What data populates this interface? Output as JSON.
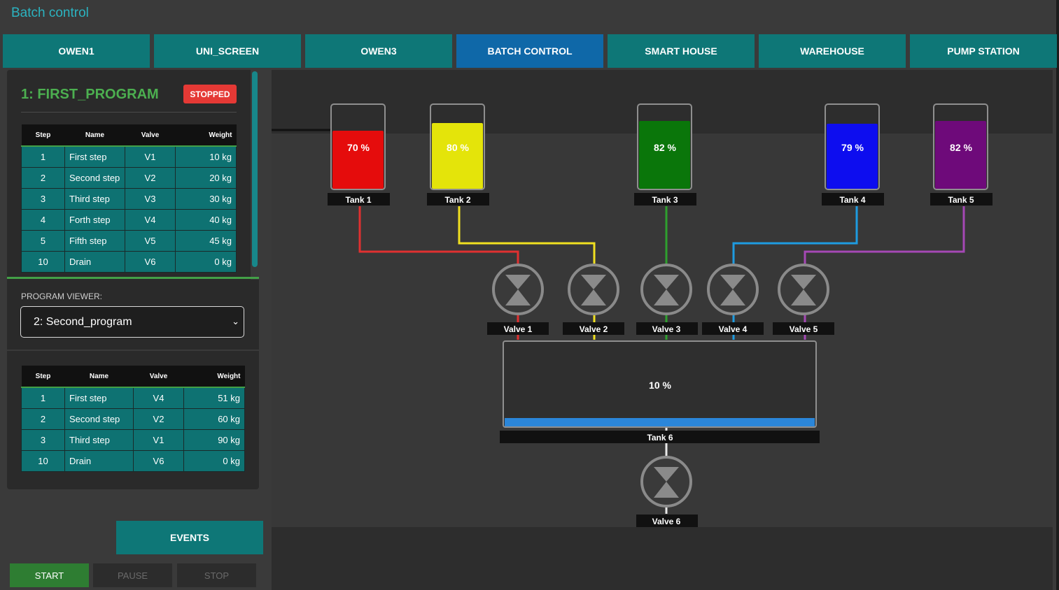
{
  "app": {
    "title": "Batch control"
  },
  "tabs": [
    {
      "label": "OWEN1",
      "active": false
    },
    {
      "label": "UNI_SCREEN",
      "active": false
    },
    {
      "label": "OWEN3",
      "active": false
    },
    {
      "label": "BATCH CONTROL",
      "active": true
    },
    {
      "label": "SMART HOUSE",
      "active": false
    },
    {
      "label": "WAREHOUSE",
      "active": false
    },
    {
      "label": "PUMP STATION",
      "active": false
    }
  ],
  "current_program": {
    "title": "1: FIRST_PROGRAM",
    "status": "STOPPED",
    "columns": {
      "step": "Step",
      "name": "Name",
      "valve": "Valve",
      "weight": "Weight"
    },
    "rows": [
      {
        "step": "1",
        "name": "First step",
        "valve": "V1",
        "weight": "10 kg"
      },
      {
        "step": "2",
        "name": "Second step",
        "valve": "V2",
        "weight": "20 kg"
      },
      {
        "step": "3",
        "name": "Third step",
        "valve": "V3",
        "weight": "30 kg"
      },
      {
        "step": "4",
        "name": "Forth step",
        "valve": "V4",
        "weight": "40 kg"
      },
      {
        "step": "5",
        "name": "Fifth step",
        "valve": "V5",
        "weight": "45 kg"
      },
      {
        "step": "10",
        "name": "Drain",
        "valve": "V6",
        "weight": "0 kg"
      }
    ]
  },
  "program_viewer": {
    "label": "PROGRAM VIEWER:",
    "selected": "2: Second_program",
    "columns": {
      "step": "Step",
      "name": "Name",
      "valve": "Valve",
      "weight": "Weight"
    },
    "rows": [
      {
        "step": "1",
        "name": "First step",
        "valve": "V4",
        "weight": "51 kg"
      },
      {
        "step": "2",
        "name": "Second step",
        "valve": "V2",
        "weight": "60 kg"
      },
      {
        "step": "3",
        "name": "Third step",
        "valve": "V1",
        "weight": "90 kg"
      },
      {
        "step": "10",
        "name": "Drain",
        "valve": "V6",
        "weight": "0 kg"
      }
    ]
  },
  "buttons": {
    "events": "EVENTS",
    "start": "START",
    "pause": "PAUSE",
    "stop": "STOP"
  },
  "tanks": [
    {
      "id": "tank-1",
      "label": "Tank 1",
      "level_text": "70 %",
      "level": 0.7,
      "color": "#e50c0c",
      "pipe_color": "#e03030"
    },
    {
      "id": "tank-2",
      "label": "Tank 2",
      "level_text": "80 %",
      "level": 0.8,
      "color": "#e4e40a",
      "pipe_color": "#f0e020"
    },
    {
      "id": "tank-3",
      "label": "Tank 3",
      "level_text": "82 %",
      "level": 0.82,
      "color": "#0a760a",
      "pipe_color": "#2ea02e"
    },
    {
      "id": "tank-4",
      "label": "Tank 4",
      "level_text": "79 %",
      "level": 0.79,
      "color": "#0d0def",
      "pipe_color": "#1e9be0"
    },
    {
      "id": "tank-5",
      "label": "Tank 5",
      "level_text": "82 %",
      "level": 0.82,
      "color": "#6e0a7a",
      "pipe_color": "#a548b5"
    }
  ],
  "mixer": {
    "label": "Tank 6",
    "level_text": "10 %",
    "level": 0.1,
    "color": "#2b86d9"
  },
  "valves": [
    {
      "label": "Valve 1"
    },
    {
      "label": "Valve 2"
    },
    {
      "label": "Valve 3"
    },
    {
      "label": "Valve 4"
    },
    {
      "label": "Valve 5"
    },
    {
      "label": "Valve 6"
    }
  ],
  "colors": {
    "accent": "#0e7777",
    "active_tab": "#0f68a8",
    "status_stopped": "#e53935",
    "program_title": "#4caf50"
  }
}
